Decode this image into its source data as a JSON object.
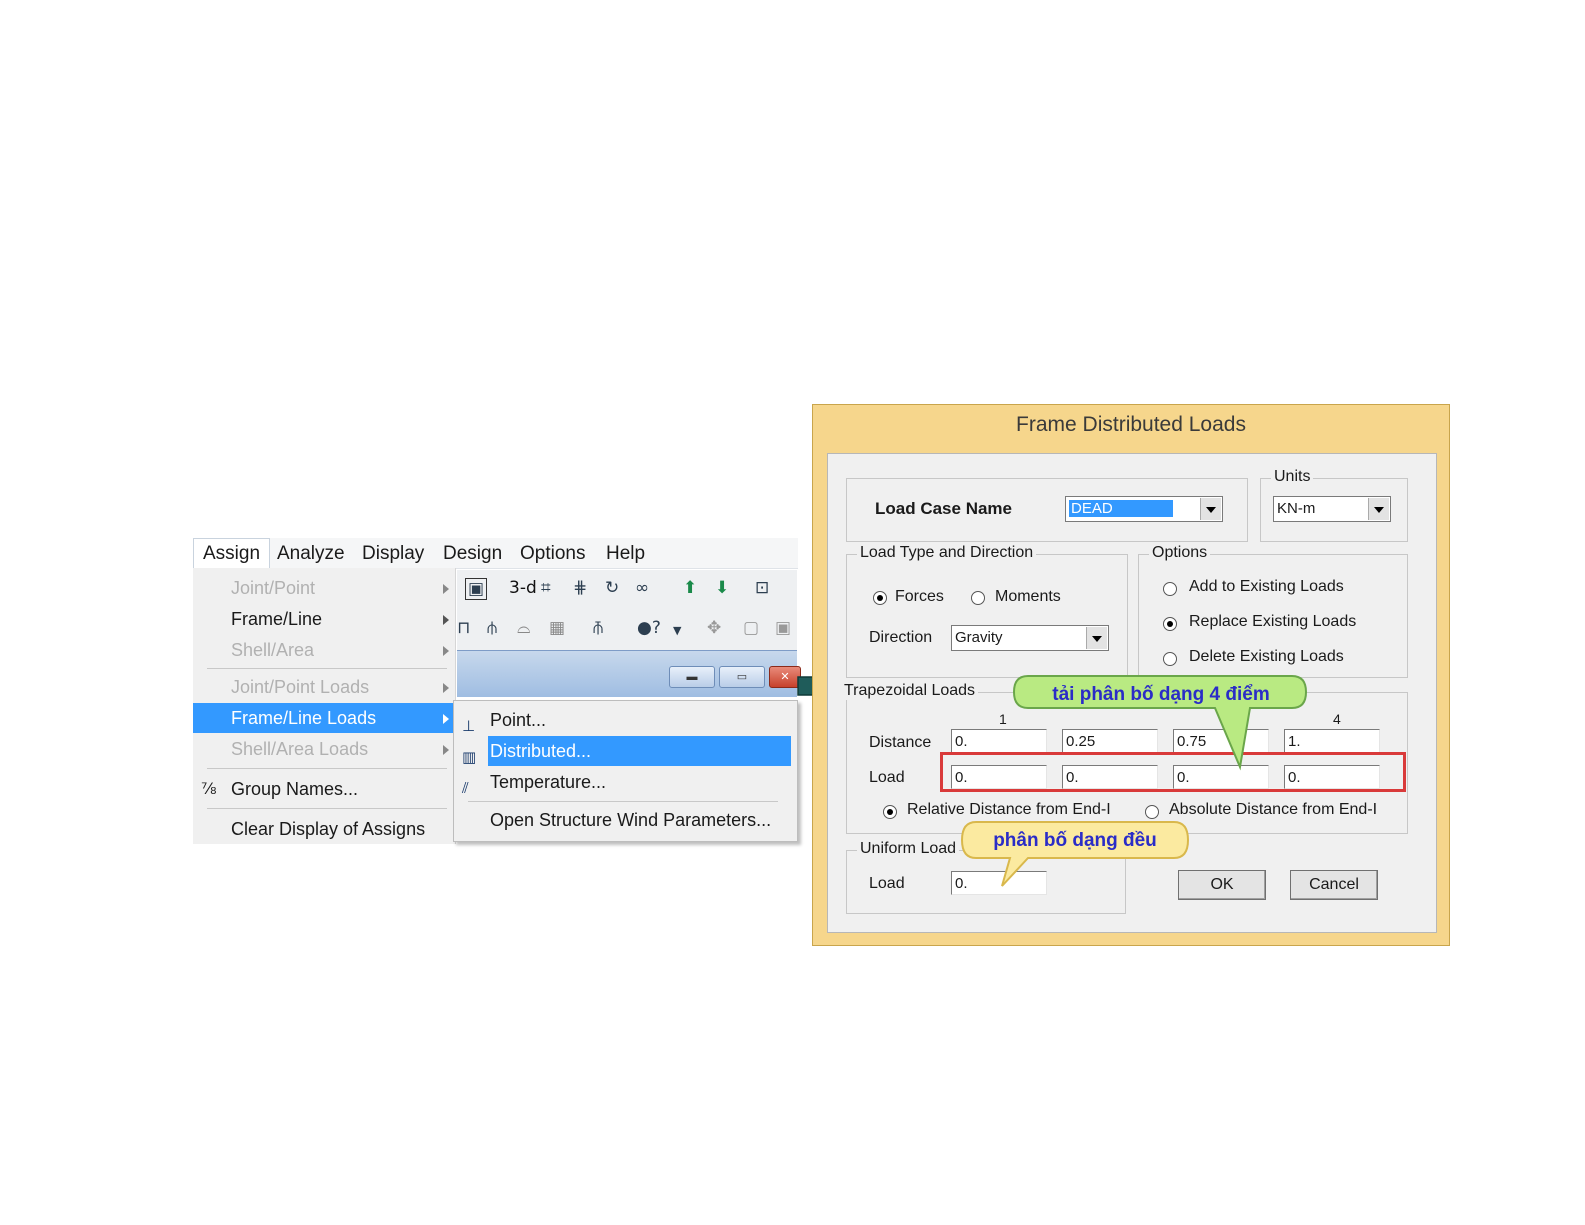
{
  "menubar": {
    "items": [
      "Assign",
      "Analyze",
      "Display",
      "Design",
      "Options",
      "Help"
    ]
  },
  "assign_menu": {
    "items": [
      {
        "label": "Joint/Point",
        "disabled": true
      },
      {
        "label": "Frame/Line",
        "disabled": false
      },
      {
        "label": "Shell/Area",
        "disabled": true
      },
      {
        "label": "Joint/Point Loads",
        "disabled": true
      },
      {
        "label": "Frame/Line Loads",
        "highlighted": true
      },
      {
        "label": "Shell/Area Loads",
        "disabled": true
      },
      {
        "label": "Group Names...",
        "disabled": false
      },
      {
        "label": "Clear Display of Assigns",
        "disabled": false
      }
    ]
  },
  "toolbar": {
    "view_3d_label": "3-d"
  },
  "submenu": {
    "items": [
      {
        "label": "Point..."
      },
      {
        "label": "Distributed...",
        "highlighted": true
      },
      {
        "label": "Temperature..."
      },
      {
        "label": "Open Structure Wind Parameters..."
      }
    ]
  },
  "dialog": {
    "title": "Frame Distributed Loads",
    "load_case_label": "Load Case Name",
    "load_case_value": "DEAD",
    "units_title": "Units",
    "units_value": "KN-m",
    "load_type_title": "Load Type and Direction",
    "forces_label": "Forces",
    "moments_label": "Moments",
    "direction_label": "Direction",
    "direction_value": "Gravity",
    "options_title": "Options",
    "option_add": "Add to Existing Loads",
    "option_replace": "Replace Existing Loads",
    "option_delete": "Delete Existing Loads",
    "trap_title": "Trapezoidal Loads",
    "col1": "1",
    "col4": "4",
    "distance_label": "Distance",
    "load_label": "Load",
    "distances": [
      "0.",
      "0.25",
      "0.75",
      "1."
    ],
    "loads": [
      "0.",
      "0.",
      "0.",
      "0."
    ],
    "relative_label": "Relative Distance from End-I",
    "absolute_label": "Absolute Distance from End-I",
    "uniform_title": "Uniform Load",
    "uniform_load_label": "Load",
    "uniform_load_value": "0.",
    "ok_label": "OK",
    "cancel_label": "Cancel"
  },
  "callouts": {
    "trapezoidal_note": "tải phân bố dạng 4 điểm",
    "uniform_note": "phân bố dạng đều"
  },
  "colors": {
    "menu_highlight": "#3399ff",
    "dialog_frame": "#f6d68c",
    "callout_green": "#b9ea82",
    "callout_yellow": "#fbeaa0",
    "red_box": "#d93a3a",
    "arrow": "#1f5c5a"
  }
}
